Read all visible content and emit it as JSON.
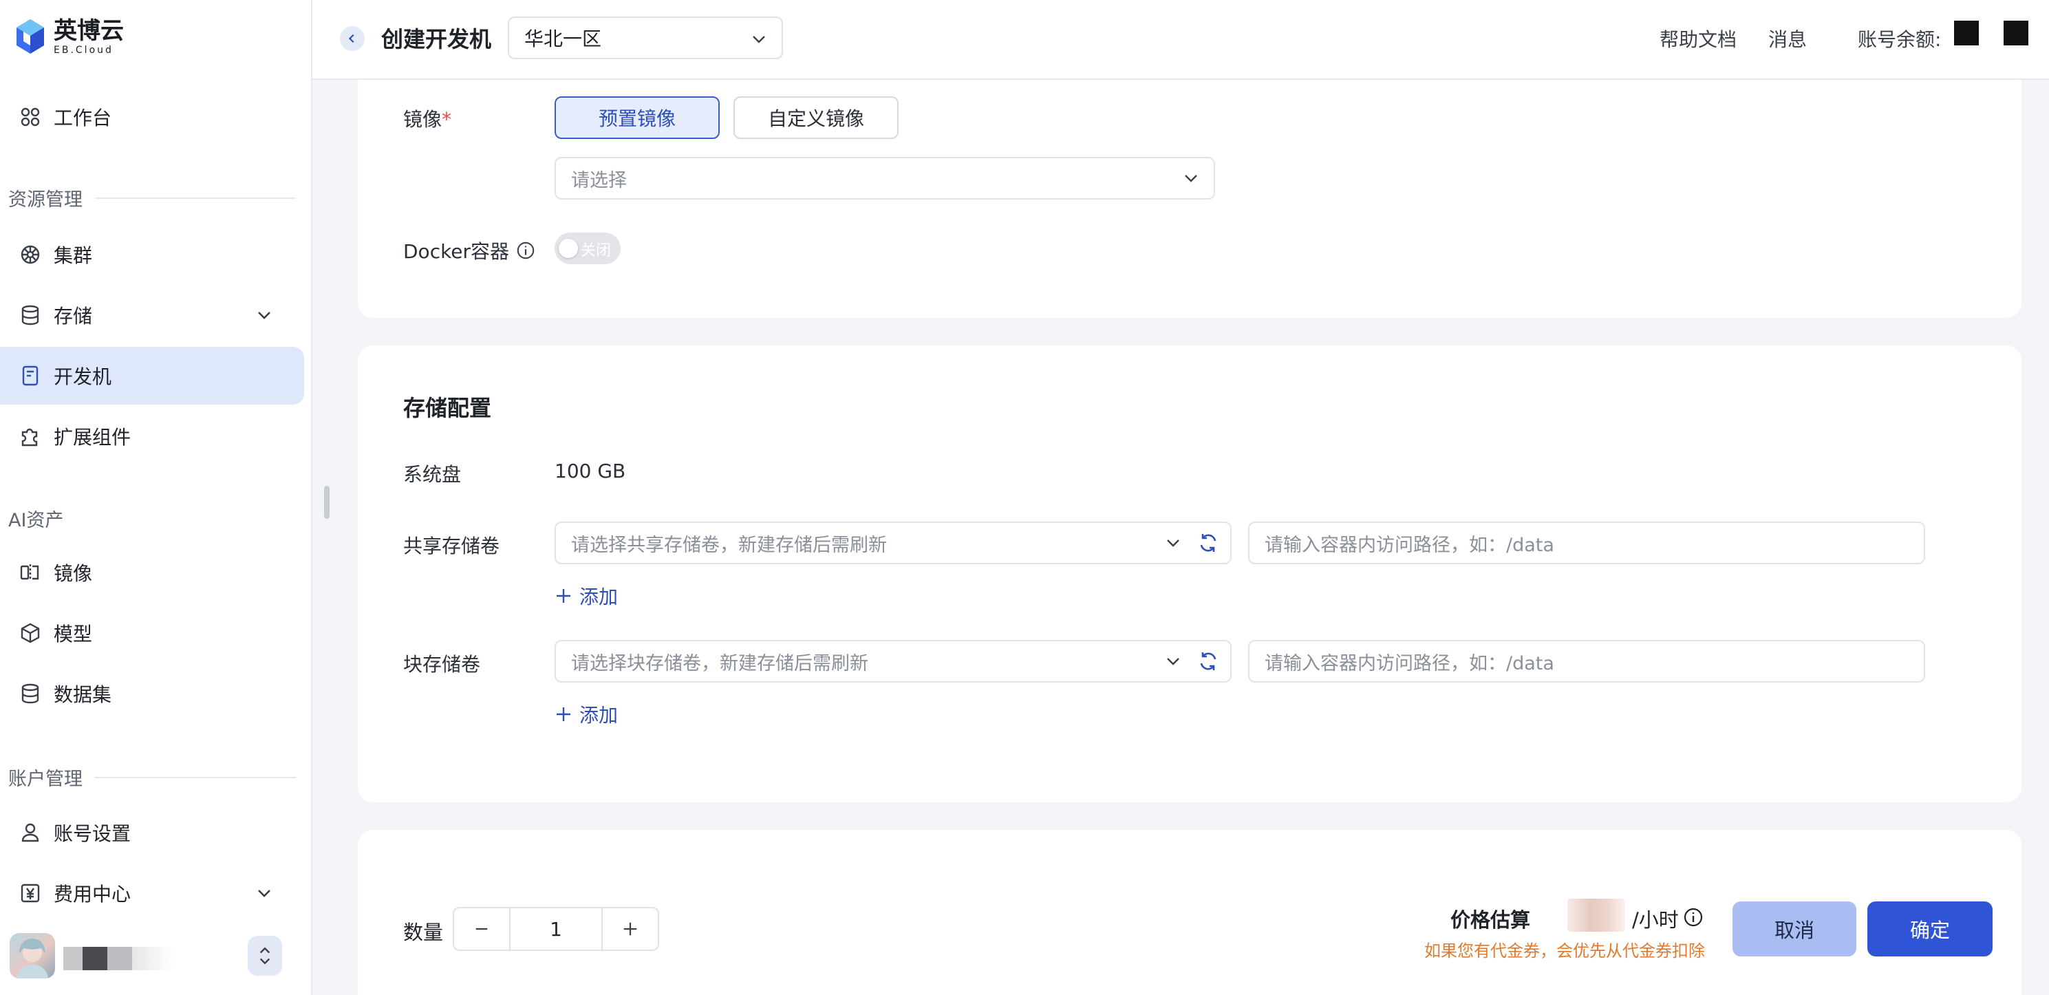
{
  "app": {
    "logo_cn": "英博云",
    "logo_en": "EB.Cloud"
  },
  "sidebar": {
    "workbench": "工作台",
    "sections": {
      "resource": "资源管理",
      "ai": "AI资产",
      "account": "账户管理"
    },
    "items": {
      "cluster": "集群",
      "storage": "存储",
      "devbox": "开发机",
      "extensions": "扩展组件",
      "image": "镜像",
      "model": "模型",
      "dataset": "数据集",
      "account_settings": "账号设置",
      "billing": "费用中心"
    }
  },
  "header": {
    "title": "创建开发机",
    "region": "华北一区",
    "help": "帮助文档",
    "messages": "消息",
    "balance_label": "账号余额:"
  },
  "image_section": {
    "label": "镜像",
    "required_mark": "*",
    "preset_btn": "预置镜像",
    "custom_btn": "自定义镜像",
    "select_placeholder": "请选择",
    "docker_label": "Docker容器",
    "docker_toggle": "关闭"
  },
  "storage_section": {
    "title": "存储配置",
    "system_disk_label": "系统盘",
    "system_disk_value": "100 GB",
    "shared_label": "共享存储卷",
    "shared_placeholder": "请选择共享存储卷，新建存储后需刷新",
    "path_placeholder": "请输入容器内访问路径，如：/data",
    "add": "添加",
    "block_label": "块存储卷",
    "block_placeholder": "请选择块存储卷，新建存储后需刷新"
  },
  "footer": {
    "quantity_label": "数量",
    "quantity_value": "1",
    "price_label": "价格估算",
    "price_unit": "/小时",
    "price_note": "如果您有代金券，会优先从代金券扣除",
    "cancel": "取消",
    "confirm": "确定"
  },
  "colors": {
    "accent": "#2f55d6",
    "active_bg": "#dfe7fb",
    "note": "#e07b2e"
  }
}
